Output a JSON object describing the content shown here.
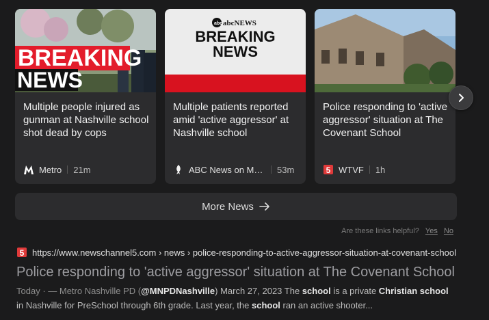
{
  "news_cards": [
    {
      "thumb_lines": [
        "BREAKING",
        "NEWS"
      ],
      "headline": "Multiple people injured as gunman at Nashville school shot dead by cops",
      "source": "Metro",
      "source_icon": "metro-logo-icon",
      "time": "21m"
    },
    {
      "thumb_brand": "abcNEWS",
      "thumb_lines": [
        "BREAKING",
        "NEWS"
      ],
      "headline": "Multiple patients reported amid 'active aggressor' at Nashville school",
      "source": "ABC News on MSN",
      "source_icon": "abc-news-logo-icon",
      "time": "53m"
    },
    {
      "headline": "Police responding to 'active aggressor' situation at The Covenant School",
      "source": "WTVF",
      "source_icon": "newschannel5-logo-icon",
      "time": "1h"
    }
  ],
  "more_news_label": "More News",
  "feedback": {
    "question": "Are these links helpful?",
    "yes": "Yes",
    "no": "No"
  },
  "result": {
    "url": "https://www.newschannel5.com › news › police-responding-to-active-aggressor-situation-at-covenant-school",
    "title": "Police responding to 'active aggressor' situation at The Covenant School",
    "date": "Today",
    "snippet_parts": {
      "p1": " · — Metro Nashville PD (",
      "b1": "@MNPDNashville",
      "p2": ") March 27, 2023 The ",
      "b2": "school",
      "p3": " is a private ",
      "b3": "Christian school",
      "p4": " in Nashville for PreSchool through 6th grade. Last year, the ",
      "b4": "school",
      "p5": " ran an active shooter..."
    }
  },
  "colors": {
    "background": "#1b1b1c",
    "card": "#2c2c2e",
    "breaking_red": "#d8121f"
  }
}
